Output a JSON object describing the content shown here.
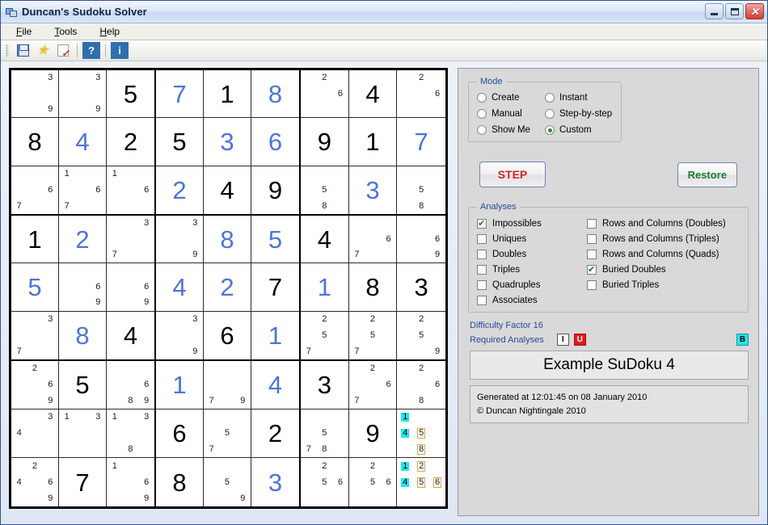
{
  "window": {
    "title": "Duncan's Sudoku Solver",
    "icon": "app-window-icon",
    "minimize": "–",
    "maximize": "□",
    "close": "✕"
  },
  "menu": [
    {
      "label": "File"
    },
    {
      "label": "Tools"
    },
    {
      "label": "Help"
    }
  ],
  "toolbar": [
    {
      "name": "save-icon",
      "glyph": ""
    },
    {
      "name": "star-icon",
      "glyph": "★"
    },
    {
      "name": "note-check-icon",
      "glyph": ""
    },
    {
      "name": "help-button",
      "glyph": "?"
    },
    {
      "name": "info-button",
      "glyph": "i"
    }
  ],
  "mode": {
    "legend": "Mode",
    "options": [
      {
        "label": "Create",
        "selected": false
      },
      {
        "label": "Instant",
        "selected": false
      },
      {
        "label": "Manual",
        "selected": false
      },
      {
        "label": "Step-by-step",
        "selected": false
      },
      {
        "label": "Show Me",
        "selected": false
      },
      {
        "label": "Custom",
        "selected": true
      }
    ]
  },
  "buttons": {
    "step": "STEP",
    "restore": "Restore"
  },
  "analyses": {
    "legend": "Analyses",
    "left": [
      {
        "label": "Impossibles",
        "checked": true
      },
      {
        "label": "Uniques",
        "checked": false
      },
      {
        "label": "Doubles",
        "checked": false
      },
      {
        "label": "Triples",
        "checked": false
      },
      {
        "label": "Quadruples",
        "checked": false
      },
      {
        "label": "Associates",
        "checked": false
      }
    ],
    "right": [
      {
        "label": "Rows and Columns (Doubles)",
        "checked": false
      },
      {
        "label": "Rows and Columns (Triples)",
        "checked": false
      },
      {
        "label": "Rows and Columns (Quads)",
        "checked": false
      },
      {
        "label": "Buried Doubles",
        "checked": true
      },
      {
        "label": "Buried Triples",
        "checked": false
      }
    ]
  },
  "status": {
    "difficulty": "Difficulty Factor 16",
    "required_label": "Required Analyses",
    "badges": [
      {
        "text": "I",
        "color": "#ffffff"
      },
      {
        "text": "U",
        "color": "#e01b1b"
      },
      {
        "text": "B",
        "color": "#22e6ef"
      }
    ],
    "puzzle_name": "Example SuDoku 4",
    "generated": "Generated at 12:01:45 on 08 January 2010",
    "copyright": "© Duncan Nightingale 2010"
  },
  "colors": {
    "given": "#000000",
    "placed": "#4d74d8",
    "highlight": "#22e6ef",
    "boxed": "#e0a63c",
    "legend_text": "#2b4a9c",
    "step_text": "#d0252a",
    "restore_text": "#1c7a2e"
  },
  "grid": {
    "rows": [
      [
        {
          "cands": [
            3,
            9
          ]
        },
        {
          "cands": [
            3,
            9
          ]
        },
        {
          "value": 5,
          "state": "given"
        },
        {
          "value": 7,
          "state": "placed"
        },
        {
          "value": 1,
          "state": "given"
        },
        {
          "value": 8,
          "state": "placed"
        },
        {
          "cands": [
            2,
            6
          ]
        },
        {
          "value": 4,
          "state": "given"
        },
        {
          "cands": [
            2,
            6
          ]
        }
      ],
      [
        {
          "value": 8,
          "state": "given"
        },
        {
          "value": 4,
          "state": "placed"
        },
        {
          "value": 2,
          "state": "given"
        },
        {
          "value": 5,
          "state": "given"
        },
        {
          "value": 3,
          "state": "placed"
        },
        {
          "value": 6,
          "state": "placed"
        },
        {
          "value": 9,
          "state": "given"
        },
        {
          "value": 1,
          "state": "given"
        },
        {
          "value": 7,
          "state": "placed"
        }
      ],
      [
        {
          "cands": [
            6,
            7
          ]
        },
        {
          "cands": [
            1,
            6,
            7
          ]
        },
        {
          "cands": [
            1,
            6
          ]
        },
        {
          "value": 2,
          "state": "placed"
        },
        {
          "value": 4,
          "state": "given"
        },
        {
          "value": 9,
          "state": "given"
        },
        {
          "cands": [
            5,
            8
          ]
        },
        {
          "value": 3,
          "state": "placed"
        },
        {
          "cands": [
            5,
            8
          ]
        }
      ],
      [
        {
          "value": 1,
          "state": "given"
        },
        {
          "value": 2,
          "state": "placed"
        },
        {
          "cands": [
            3,
            7
          ]
        },
        {
          "cands": [
            3,
            9
          ]
        },
        {
          "value": 8,
          "state": "placed"
        },
        {
          "value": 5,
          "state": "placed"
        },
        {
          "value": 4,
          "state": "given"
        },
        {
          "cands": [
            6,
            7
          ]
        },
        {
          "cands": [
            6,
            9
          ]
        }
      ],
      [
        {
          "value": 5,
          "state": "placed"
        },
        {
          "cands": [
            6,
            9
          ]
        },
        {
          "cands": [
            6,
            9
          ]
        },
        {
          "value": 4,
          "state": "placed"
        },
        {
          "value": 2,
          "state": "placed"
        },
        {
          "value": 7,
          "state": "given"
        },
        {
          "value": 1,
          "state": "placed"
        },
        {
          "value": 8,
          "state": "given"
        },
        {
          "value": 3,
          "state": "given"
        }
      ],
      [
        {
          "cands": [
            3,
            7
          ]
        },
        {
          "value": 8,
          "state": "placed"
        },
        {
          "value": 4,
          "state": "given"
        },
        {
          "cands": [
            3,
            9
          ]
        },
        {
          "value": 6,
          "state": "given"
        },
        {
          "value": 1,
          "state": "placed"
        },
        {
          "cands": [
            2,
            5,
            7
          ]
        },
        {
          "cands": [
            2,
            5,
            7
          ]
        },
        {
          "cands": [
            2,
            5,
            9
          ]
        }
      ],
      [
        {
          "cands": [
            2,
            6,
            9
          ]
        },
        {
          "value": 5,
          "state": "given"
        },
        {
          "cands": [
            6,
            8,
            9
          ]
        },
        {
          "value": 1,
          "state": "placed"
        },
        {
          "cands": [
            7,
            9
          ]
        },
        {
          "value": 4,
          "state": "placed"
        },
        {
          "value": 3,
          "state": "given"
        },
        {
          "cands": [
            2,
            6,
            7
          ]
        },
        {
          "cands": [
            2,
            6,
            8
          ]
        }
      ],
      [
        {
          "cands": [
            3,
            4
          ]
        },
        {
          "cands": [
            1,
            3
          ]
        },
        {
          "cands": [
            1,
            3,
            8
          ]
        },
        {
          "value": 6,
          "state": "given"
        },
        {
          "cands": [
            5,
            7
          ]
        },
        {
          "value": 2,
          "state": "given"
        },
        {
          "cands": [
            5,
            7,
            8
          ]
        },
        {
          "value": 9,
          "state": "given"
        },
        {
          "cands": [
            1,
            4,
            5,
            8
          ],
          "hl": [
            1,
            4
          ],
          "bx": [
            5,
            8
          ]
        }
      ],
      [
        {
          "cands": [
            2,
            4,
            6,
            9
          ]
        },
        {
          "value": 7,
          "state": "given"
        },
        {
          "cands": [
            1,
            6,
            9
          ]
        },
        {
          "value": 8,
          "state": "given"
        },
        {
          "cands": [
            5,
            9
          ]
        },
        {
          "value": 3,
          "state": "placed"
        },
        {
          "cands": [
            2,
            5,
            6
          ]
        },
        {
          "cands": [
            2,
            5,
            6
          ]
        },
        {
          "cands": [
            1,
            2,
            4,
            5,
            6
          ],
          "hl": [
            1,
            4
          ],
          "bx": [
            2,
            5,
            6
          ]
        }
      ]
    ]
  }
}
